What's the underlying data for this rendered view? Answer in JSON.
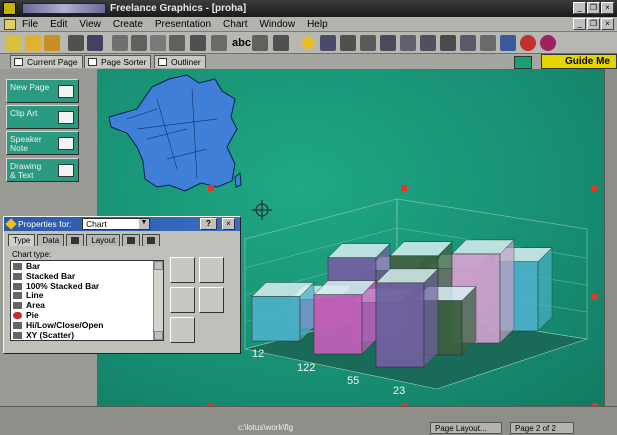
{
  "titlebar": {
    "title": "Freelance Graphics - [proha]",
    "buttons": [
      "_",
      "❐",
      "×"
    ]
  },
  "menubar": {
    "items": [
      "File",
      "Edit",
      "View",
      "Create",
      "Presentation",
      "Chart",
      "Window",
      "Help"
    ],
    "buttons": [
      "_",
      "❐",
      "×"
    ]
  },
  "toolbar": {
    "abc_label": "abc"
  },
  "tabs": {
    "current_page": "Current Page",
    "page_sorter": "Page Sorter",
    "outliner": "Outliner",
    "guide_me": "Guide Me"
  },
  "left_panel": {
    "new_page": "New Page",
    "clip_art": "Clip Art",
    "speaker_note": "Speaker Note",
    "drawing_text": "Drawing & Text"
  },
  "dialog": {
    "title": "Properties for:",
    "selected_object": "Chart",
    "help_button": "?",
    "close_button": "×",
    "tabs": [
      "Type",
      "Data",
      "",
      "Layout",
      "",
      ""
    ],
    "chart_type_label": "Chart type:",
    "chart_types": [
      "Bar",
      "Stacked Bar",
      "100% Stacked Bar",
      "Line",
      "Area",
      "Pie",
      "Hi/Low/Close/Open",
      "XY (Scatter)"
    ]
  },
  "chart_data": {
    "type": "bar",
    "style": "3d",
    "series": [
      {
        "name": "",
        "values": [
          45,
          60,
          85
        ]
      },
      {
        "name": "",
        "values": [
          30,
          40,
          55
        ]
      },
      {
        "name": "",
        "values": [
          60,
          75,
          90
        ]
      },
      {
        "name": "",
        "values": [
          35,
          50,
          70
        ]
      }
    ],
    "categories": [
      "12",
      "122",
      "55",
      "23"
    ],
    "tick_labels": [
      "12",
      "122",
      "55",
      "23"
    ],
    "colors": [
      "#4ab0c8",
      "#c060b8",
      "#7060a0",
      "#3a6040",
      "#c8a0c8"
    ]
  },
  "statusbar": {
    "path": "c:\\lotus\\work\\flg",
    "layout": "Page Layout...",
    "page": "Page 2 of 2"
  }
}
